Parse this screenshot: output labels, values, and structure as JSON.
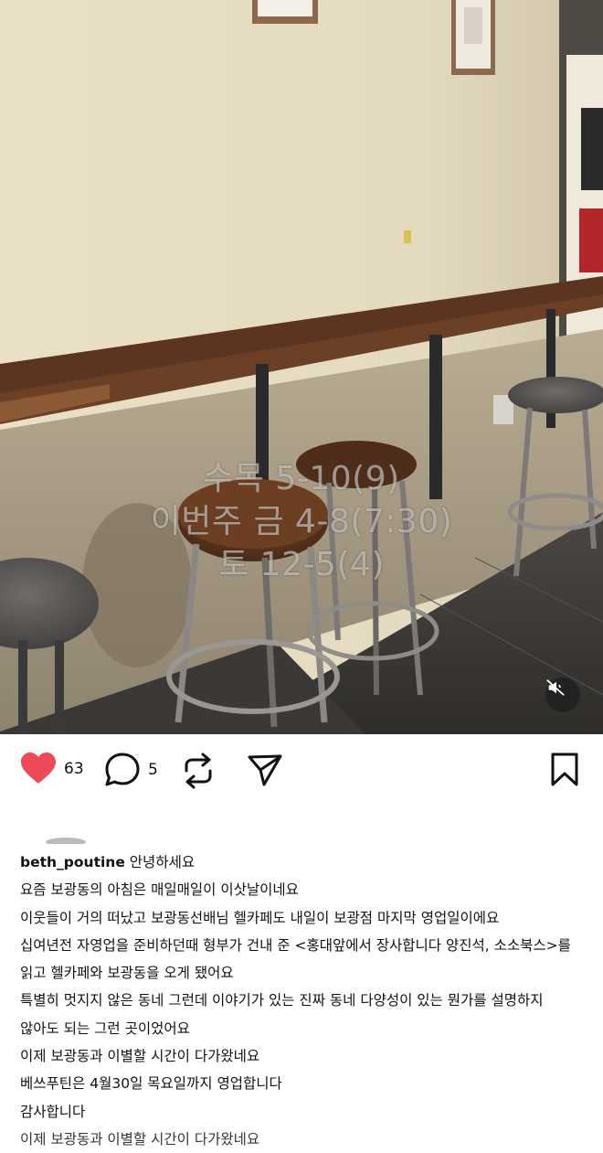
{
  "post": {
    "overlay": [
      "수목 5-10(9)",
      "이번주 금 4-8(7:30)",
      "토 12-5(4)"
    ],
    "like_count": "63",
    "comment_count": "5",
    "username": "beth_poutine",
    "caption_lines": [
      "안녕하세요",
      "요즘 보광동의 아침은 매일매일이 이삿날이네요",
      "이웃들이 거의 떠났고 보광동선배님 헬카페도 내일이 보광점 마지막 영업일이에요",
      "십여년전 자영업을 준비하던때 형부가 건내 준 <홍대앞에서 장사합니다 양진석, 소소북스>를",
      "읽고 헬카페와 보광동을 오게 됐어요",
      "특별히 멋지지 않은 동네 그런데 이야기가 있는 진짜 동네 다양성이 있는 뭔가를 설명하지",
      "않아도 되는 그런 곳이었어요",
      "이제 보광동과 이별할 시간이 다가왔네요",
      "베쓰푸틴은 4월30일 목요일까지 영업합니다",
      "감사합니다",
      "이제 보광동과 이별할 시간이 다가왔네요"
    ]
  },
  "icons": {
    "like": "heart-icon",
    "comment": "comment-icon",
    "repost": "repost-icon",
    "share": "send-icon",
    "save": "bookmark-icon",
    "mute": "speaker-muted-icon"
  },
  "colors": {
    "like": "#ed4956",
    "text": "#111111",
    "background": "#ffffff"
  }
}
